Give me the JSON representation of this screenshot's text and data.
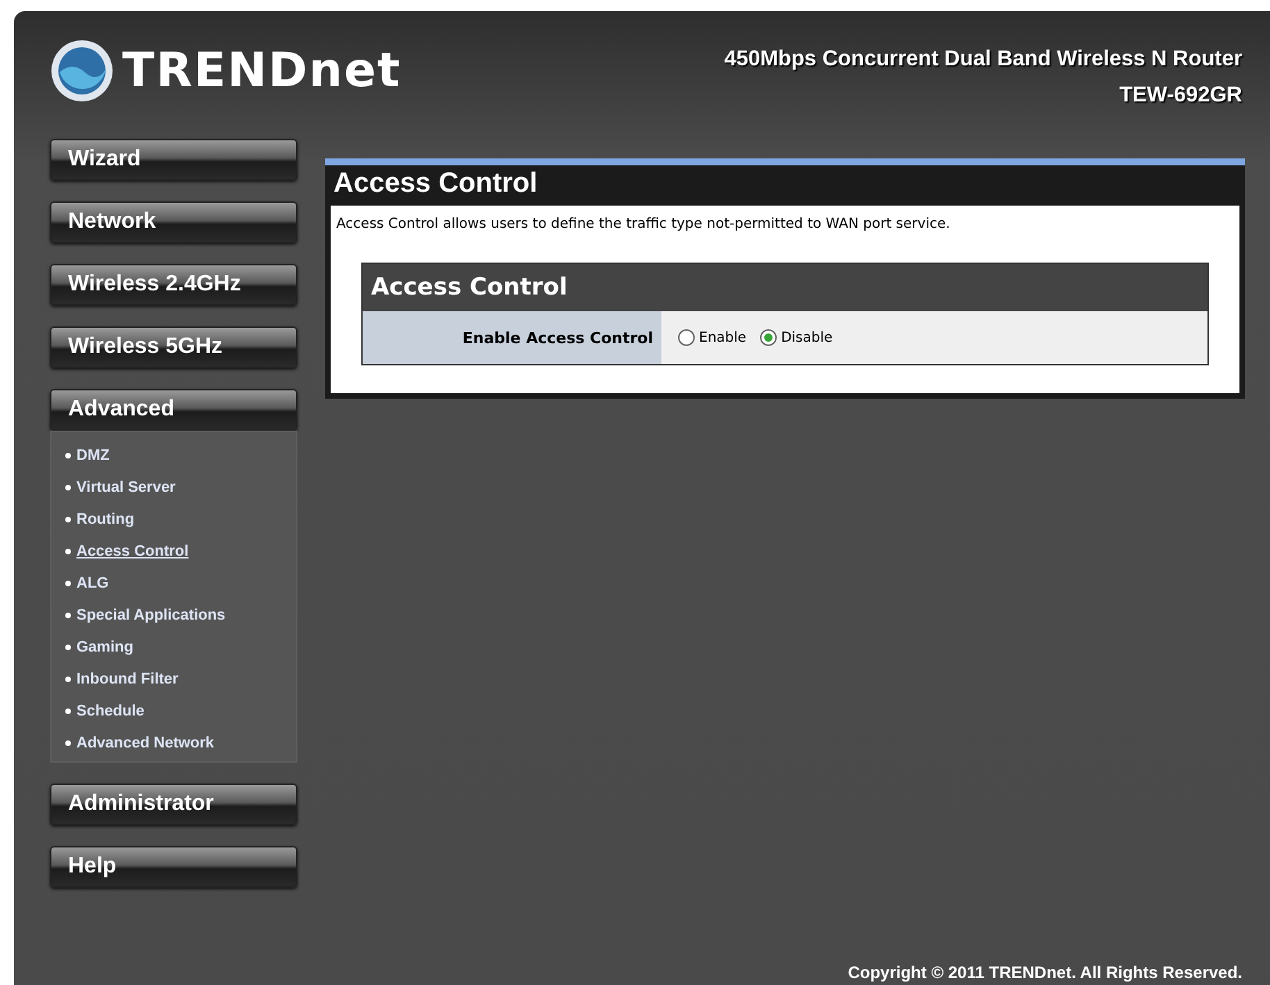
{
  "header": {
    "brand": "TRENDnet",
    "product": "450Mbps Concurrent Dual Band Wireless N Router",
    "model": "TEW-692GR"
  },
  "menu": [
    {
      "label": "Wizard",
      "kind": "button"
    },
    {
      "label": "Network",
      "kind": "button"
    },
    {
      "label": "Wireless 2.4GHz",
      "kind": "button"
    },
    {
      "label": "Wireless 5GHz",
      "kind": "button"
    },
    {
      "label": "Advanced",
      "kind": "button"
    },
    {
      "kind": "submenu",
      "items": [
        {
          "label": "DMZ",
          "selected": false
        },
        {
          "label": "Virtual Server",
          "selected": false
        },
        {
          "label": "Routing",
          "selected": false
        },
        {
          "label": "Access Control",
          "selected": true
        },
        {
          "label": "ALG",
          "selected": false
        },
        {
          "label": "Special Applications",
          "selected": false
        },
        {
          "label": "Gaming",
          "selected": false
        },
        {
          "label": "Inbound Filter",
          "selected": false
        },
        {
          "label": "Schedule",
          "selected": false
        },
        {
          "label": "Advanced Network",
          "selected": false
        }
      ]
    },
    {
      "label": "Administrator",
      "kind": "button"
    },
    {
      "label": "Help",
      "kind": "button"
    }
  ],
  "content": {
    "title": "Access Control",
    "description": "Access Control allows users to define the traffic type not-permitted to WAN port service.",
    "section": {
      "title": "Access Control",
      "field_label": "Enable Access Control",
      "options": [
        {
          "label": "Enable",
          "selected": false
        },
        {
          "label": "Disable",
          "selected": true
        }
      ]
    }
  },
  "footer": "Copyright © 2011 TRENDnet. All Rights Reserved."
}
